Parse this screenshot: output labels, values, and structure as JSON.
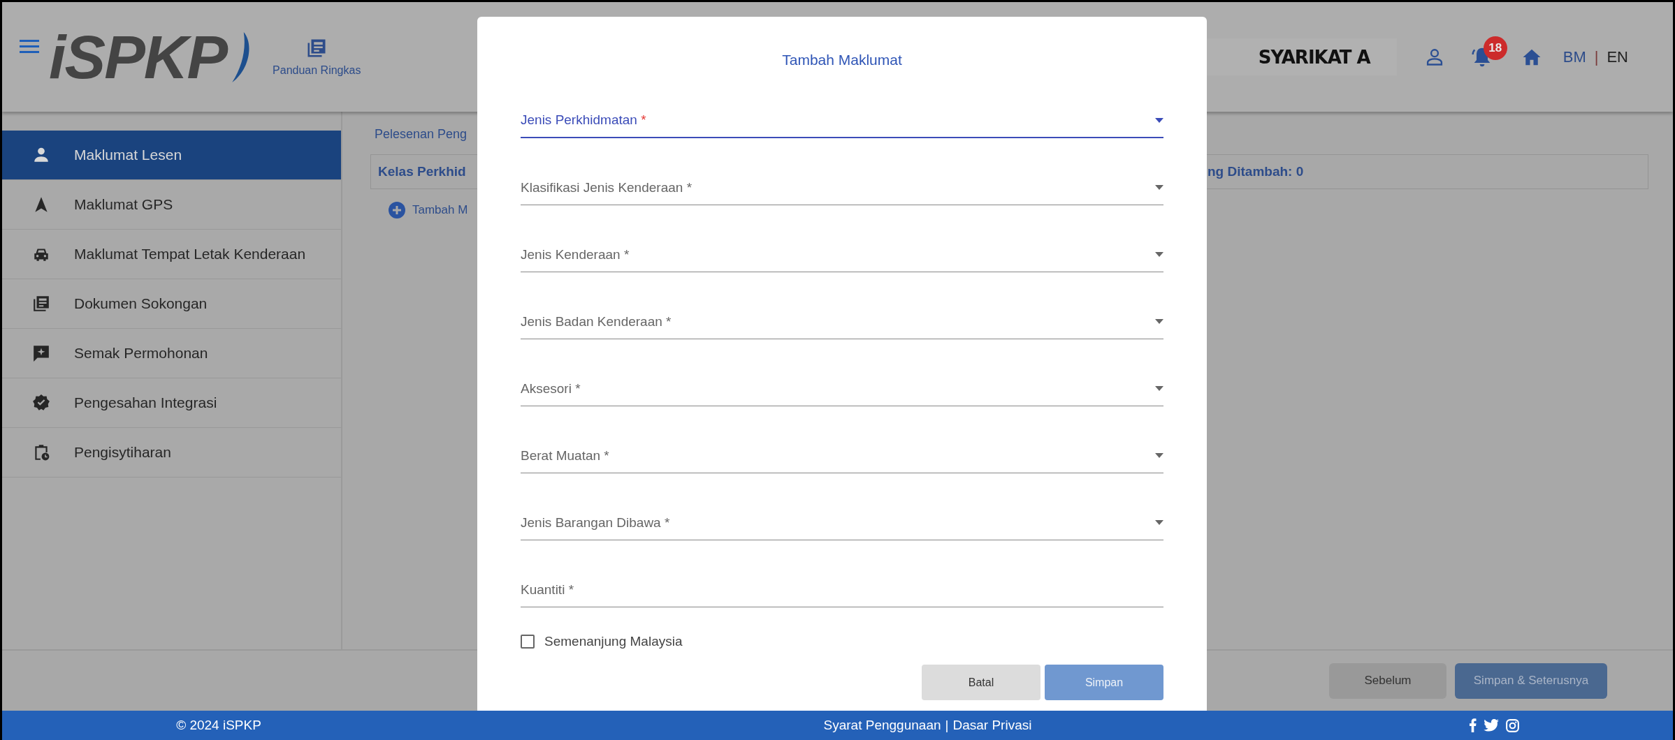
{
  "header": {
    "logo": "iSPKP",
    "guide_link": "Panduan Ringkas",
    "company": "SYARIKAT A",
    "notification_count": "18",
    "languages": [
      {
        "label": "BM",
        "selected": false
      },
      {
        "label": "EN",
        "selected": true
      }
    ],
    "language_separator": "|"
  },
  "sidebar": {
    "items": [
      {
        "label": "Maklumat Lesen",
        "selected": true
      },
      {
        "label": "Maklumat GPS",
        "selected": false
      },
      {
        "label": "Maklumat Tempat Letak Kenderaan",
        "selected": false
      },
      {
        "label": "Dokumen Sokongan",
        "selected": false
      },
      {
        "label": "Semak Permohonan",
        "selected": false
      },
      {
        "label": "Pengesahan Integrasi",
        "selected": false
      },
      {
        "label": "Pengisytiharan",
        "selected": false
      }
    ]
  },
  "content": {
    "heading": "Pelesenan Peng",
    "summary_left": "Kelas Perkhid",
    "summary_right": "ng Ditambah: 0",
    "add_link": "Tambah M"
  },
  "actions": [
    {
      "label": "Sebelum",
      "kind": "secondary"
    },
    {
      "label": "Simpan & Seterusnya",
      "kind": "primary"
    }
  ],
  "footer": {
    "copyright": "© 2024 iSPKP",
    "links": [
      {
        "label": "Syarat Penggunaan"
      },
      {
        "label": "Dasar Privasi"
      }
    ],
    "separator": "|"
  },
  "dialog": {
    "title": "Tambah Maklumat",
    "fields": [
      {
        "label": "Jenis Perkhidmatan",
        "marker": "*",
        "kind": "select",
        "focused": true
      },
      {
        "label": "Klasifikasi Jenis Kenderaan",
        "marker": "*",
        "kind": "select",
        "focused": false
      },
      {
        "label": "Jenis Kenderaan",
        "marker": "*",
        "kind": "select",
        "focused": false
      },
      {
        "label": "Jenis Badan Kenderaan",
        "marker": "*",
        "kind": "select",
        "focused": false
      },
      {
        "label": "Aksesori",
        "marker": "*",
        "kind": "select",
        "focused": false
      },
      {
        "label": "Berat Muatan",
        "marker": "*",
        "kind": "select",
        "focused": false
      },
      {
        "label": "Jenis Barangan Dibawa",
        "marker": "*",
        "kind": "select",
        "focused": false
      },
      {
        "label": "Kuantiti",
        "marker": "*",
        "kind": "text",
        "focused": false
      }
    ],
    "checkbox": {
      "label": "Semenanjung Malaysia",
      "checked": false
    },
    "buttons": [
      {
        "label": "Batal",
        "kind": "secondary",
        "disabled": false
      },
      {
        "label": "Simpan",
        "kind": "primary",
        "disabled": true
      }
    ]
  }
}
